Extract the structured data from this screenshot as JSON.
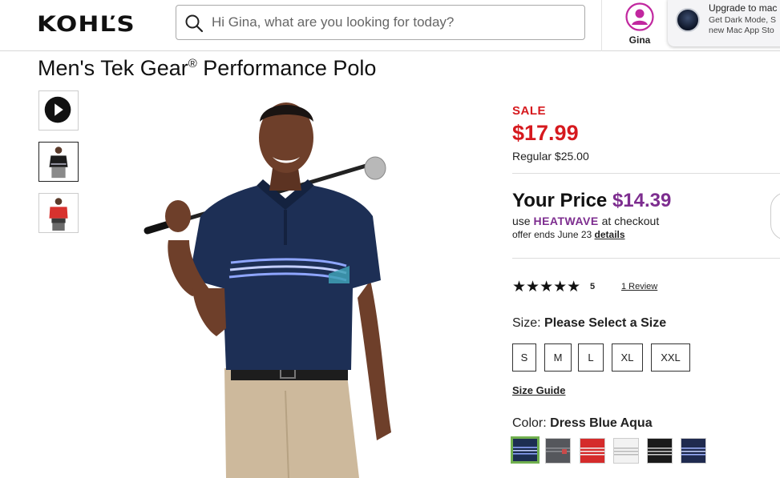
{
  "header": {
    "logo": "KOHĽS",
    "search_placeholder": "Hi Gina, what are you looking for today?",
    "account_name": "Gina"
  },
  "notification": {
    "title": "Upgrade to mac",
    "body_line1": "Get Dark Mode, S",
    "body_line2": "new Mac App Sto"
  },
  "product": {
    "title": "Men's Tek Gear",
    "title_mark": "®",
    "title_rest": " Performance Polo",
    "thumbnails": [
      "video-thumbnail",
      "navy-polo-front",
      "red-polo-model"
    ]
  },
  "pricing": {
    "sale_label": "SALE",
    "sale_price": "$17.99",
    "regular": "Regular $25.00",
    "your_price_label": "Your Price",
    "your_price_amount": "$14.39",
    "promo_prefix": "use ",
    "promo_code": "HEATWAVE",
    "promo_suffix": " at checkout",
    "offer_text": "offer ends June 23 ",
    "details_link": "details"
  },
  "rating": {
    "stars": "★★★★★",
    "value": "5",
    "reviews_link": "1 Review"
  },
  "size": {
    "label": "Size:",
    "selection": "Please Select a Size",
    "options": [
      "S",
      "M",
      "L",
      "XL",
      "XXL"
    ],
    "guide": "Size Guide"
  },
  "color": {
    "label": "Color:",
    "selection": "Dress Blue Aqua",
    "swatches": [
      {
        "name": "Dress Blue Aqua",
        "base": "#1d2e52",
        "stripe": "#8fa6ff"
      },
      {
        "name": "Grey",
        "base": "#55575c",
        "stripe": "#c94a4a"
      },
      {
        "name": "Red",
        "base": "#d52b2b",
        "stripe": "#f2f2f2"
      },
      {
        "name": "White",
        "base": "#f2f2f2",
        "stripe": "#b9b9b9"
      },
      {
        "name": "Black",
        "base": "#1a1a1a",
        "stripe": "#cfcfcf"
      },
      {
        "name": "Navy",
        "base": "#1f2a4f",
        "stripe": "#9fb3ff"
      }
    ]
  },
  "colors": {
    "sale_red": "#d6191e",
    "promo_purple": "#7d2d8f",
    "account_pink": "#c1279f",
    "selected_swatch": "#71b04f"
  }
}
